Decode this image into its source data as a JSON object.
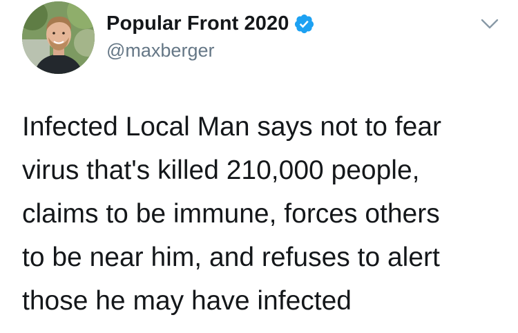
{
  "tweet": {
    "display_name": "Popular Front 2020",
    "handle": "@maxberger",
    "text": "Infected Local Man says not to fear\nvirus that's killed 210,000 people,\nclaims to be immune, forces others\nto be near him, and refuses to alert\nthose he may have infected",
    "verified": true
  },
  "icons": {
    "verified": "verified-badge-icon",
    "menu": "chevron-down-icon"
  },
  "colors": {
    "verified_blue": "#1da1f2",
    "handle_gray": "#657786",
    "text": "#14171a",
    "background": "#ffffff"
  }
}
